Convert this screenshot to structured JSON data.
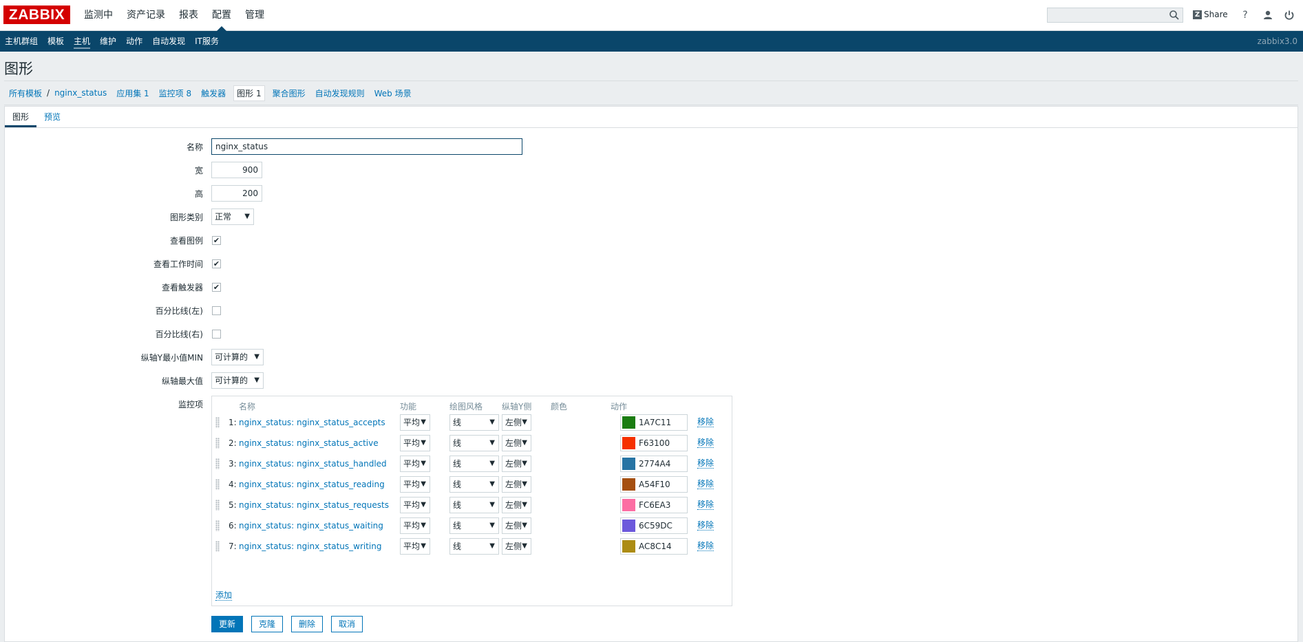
{
  "app": {
    "logo": "ZABBIX",
    "version": "zabbix3.0"
  },
  "main_menu": [
    {
      "label": "监测中",
      "active": false
    },
    {
      "label": "资产记录",
      "active": false
    },
    {
      "label": "报表",
      "active": false
    },
    {
      "label": "配置",
      "active": true
    },
    {
      "label": "管理",
      "active": false
    }
  ],
  "header": {
    "search_placeholder": "",
    "share_label": "Share",
    "help_icon": "help-icon",
    "user_icon": "user-icon",
    "logout_icon": "power-icon"
  },
  "sub_menu": [
    {
      "label": "主机群组",
      "active": false
    },
    {
      "label": "模板",
      "active": false
    },
    {
      "label": "主机",
      "active": true
    },
    {
      "label": "维护",
      "active": false
    },
    {
      "label": "动作",
      "active": false
    },
    {
      "label": "自动发现",
      "active": false
    },
    {
      "label": "IT服务",
      "active": false
    }
  ],
  "page_title": "图形",
  "breadcrumb": {
    "all_templates": "所有模板",
    "separator": "/",
    "template": "nginx_status",
    "applications": "应用集 1",
    "items": "监控项 8",
    "triggers": "触发器",
    "graphs": "图形 1",
    "screens": "聚合图形",
    "discovery": "自动发现规则",
    "web": "Web 场景"
  },
  "tabs": {
    "graph": "图形",
    "preview": "预览"
  },
  "form": {
    "name_label": "名称",
    "name_value": "nginx_status",
    "width_label": "宽",
    "width_value": "900",
    "height_label": "高",
    "height_value": "200",
    "graph_type_label": "图形类别",
    "graph_type_value": "正常",
    "show_legend_label": "查看图例",
    "show_legend": true,
    "show_work_period_label": "查看工作时间",
    "show_work_period": true,
    "show_triggers_label": "查看触发器",
    "show_triggers": true,
    "percentile_left_label": "百分比线(左)",
    "percentile_left": false,
    "percentile_right_label": "百分比线(右)",
    "percentile_right": false,
    "y_min_label": "纵轴Y最小值MIN",
    "y_min_value": "可计算的",
    "y_max_label": "纵轴最大值",
    "y_max_value": "可计算的",
    "items_label": "监控项"
  },
  "items_table": {
    "headers": {
      "name": "名称",
      "function": "功能",
      "draw_style": "绘图风格",
      "y_axis": "纵轴Y侧",
      "color": "颜色",
      "action": "动作"
    },
    "rows": [
      {
        "num": "1:",
        "name": "nginx_status: nginx_status_accepts",
        "function": "平均",
        "style": "线",
        "axis": "左侧",
        "color": "1A7C11",
        "color_hex": "#1A7C11",
        "remove": "移除"
      },
      {
        "num": "2:",
        "name": "nginx_status: nginx_status_active",
        "function": "平均",
        "style": "线",
        "axis": "左侧",
        "color": "F63100",
        "color_hex": "#F63100",
        "remove": "移除"
      },
      {
        "num": "3:",
        "name": "nginx_status: nginx_status_handled",
        "function": "平均",
        "style": "线",
        "axis": "左侧",
        "color": "2774A4",
        "color_hex": "#2774A4",
        "remove": "移除"
      },
      {
        "num": "4:",
        "name": "nginx_status: nginx_status_reading",
        "function": "平均",
        "style": "线",
        "axis": "左侧",
        "color": "A54F10",
        "color_hex": "#A54F10",
        "remove": "移除"
      },
      {
        "num": "5:",
        "name": "nginx_status: nginx_status_requests",
        "function": "平均",
        "style": "线",
        "axis": "左侧",
        "color": "FC6EA3",
        "color_hex": "#FC6EA3",
        "remove": "移除"
      },
      {
        "num": "6:",
        "name": "nginx_status: nginx_status_waiting",
        "function": "平均",
        "style": "线",
        "axis": "左侧",
        "color": "6C59DC",
        "color_hex": "#6C59DC",
        "remove": "移除"
      },
      {
        "num": "7:",
        "name": "nginx_status: nginx_status_writing",
        "function": "平均",
        "style": "线",
        "axis": "左侧",
        "color": "AC8C14",
        "color_hex": "#AC8C14",
        "remove": "移除"
      }
    ],
    "add_label": "添加"
  },
  "buttons": {
    "update": "更新",
    "clone": "克隆",
    "delete": "删除",
    "cancel": "取消"
  },
  "colors": {
    "brand": "#d40000",
    "nav": "#0a466a",
    "link": "#0275b8"
  }
}
